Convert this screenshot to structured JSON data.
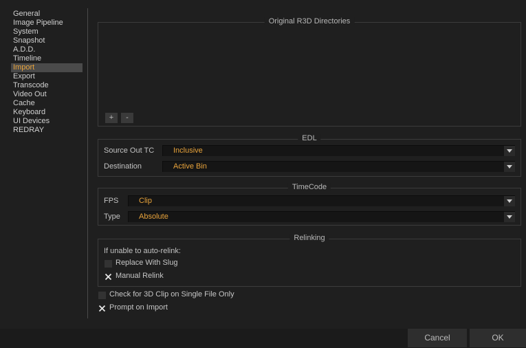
{
  "sidebar": {
    "items": [
      {
        "label": "General"
      },
      {
        "label": "Image Pipeline"
      },
      {
        "label": "System"
      },
      {
        "label": "Snapshot"
      },
      {
        "label": "A.D.D."
      },
      {
        "label": "Timeline"
      },
      {
        "label": "Import",
        "active": true
      },
      {
        "label": "Export"
      },
      {
        "label": "Transcode"
      },
      {
        "label": "Video Out"
      },
      {
        "label": "Cache"
      },
      {
        "label": "Keyboard"
      },
      {
        "label": "UI Devices"
      },
      {
        "label": "REDRAY"
      }
    ]
  },
  "directories": {
    "title": "Original R3D Directories",
    "add_label": "+",
    "remove_label": "-"
  },
  "edl": {
    "title": "EDL",
    "source_out_label": "Source Out TC",
    "source_out_value": "Inclusive",
    "destination_label": "Destination",
    "destination_value": "Active Bin"
  },
  "timecode": {
    "title": "TimeCode",
    "fps_label": "FPS",
    "fps_value": "Clip",
    "type_label": "Type",
    "type_value": "Absolute"
  },
  "relinking": {
    "title": "Relinking",
    "intro": "If unable to auto-relink:",
    "replace_label": "Replace With Slug",
    "replace_checked": false,
    "manual_label": "Manual Relink",
    "manual_checked": true
  },
  "options": {
    "check3d_label": "Check for 3D Clip on Single File Only",
    "check3d_checked": false,
    "prompt_label": "Prompt on Import",
    "prompt_checked": true
  },
  "footer": {
    "cancel_label": "Cancel",
    "ok_label": "OK"
  },
  "colors": {
    "accent": "#e8a33b",
    "background": "#1f1f1f"
  }
}
